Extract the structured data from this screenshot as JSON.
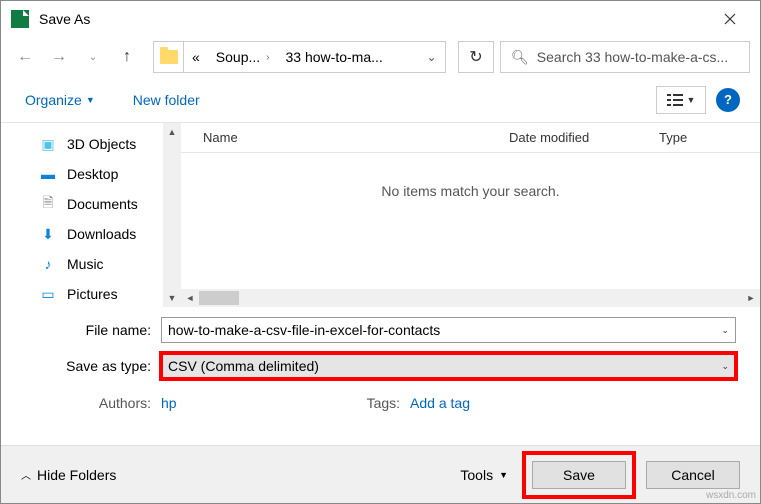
{
  "titlebar": {
    "title": "Save As"
  },
  "nav": {
    "breadcrumb": {
      "prefix": "«",
      "seg1": "Soup...",
      "seg2": "33 how-to-ma..."
    },
    "search_placeholder": "Search 33 how-to-make-a-cs..."
  },
  "toolbar": {
    "organize": "Organize",
    "new_folder": "New folder"
  },
  "sidebar": {
    "items": [
      {
        "label": "3D Objects"
      },
      {
        "label": "Desktop"
      },
      {
        "label": "Documents"
      },
      {
        "label": "Downloads"
      },
      {
        "label": "Music"
      },
      {
        "label": "Pictures"
      }
    ]
  },
  "columns": {
    "name": "Name",
    "date": "Date modified",
    "type": "Type"
  },
  "files": {
    "empty_msg": "No items match your search."
  },
  "form": {
    "filename_label": "File name:",
    "filename_value": "how-to-make-a-csv-file-in-excel-for-contacts",
    "savetype_label": "Save as type:",
    "savetype_value": "CSV (Comma delimited)",
    "authors_label": "Authors:",
    "authors_value": "hp",
    "tags_label": "Tags:",
    "tags_value": "Add a tag"
  },
  "footer": {
    "hide_folders": "Hide Folders",
    "tools": "Tools",
    "save": "Save",
    "cancel": "Cancel"
  },
  "watermark": "wsxdn.com"
}
